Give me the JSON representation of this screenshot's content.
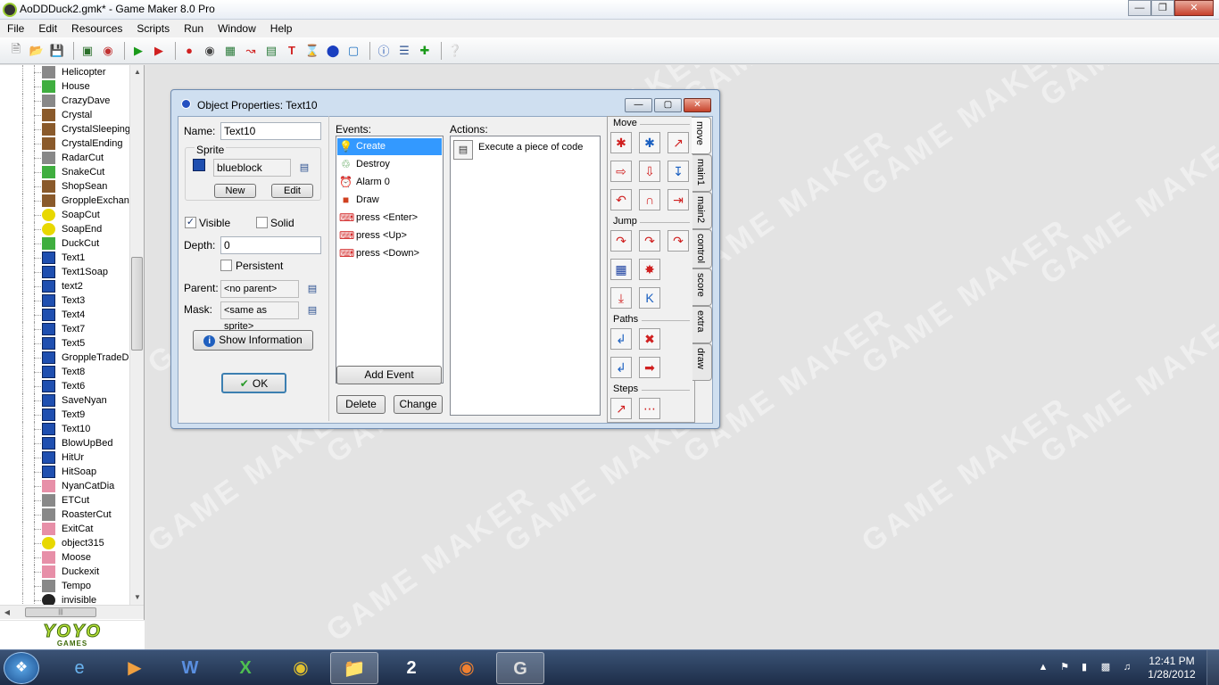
{
  "window": {
    "title": "AoDDDuck2.gmk* - Game Maker 8.0 Pro"
  },
  "menu": [
    "File",
    "Edit",
    "Resources",
    "Scripts",
    "Run",
    "Window",
    "Help"
  ],
  "tree_items": [
    {
      "label": "Helicopter",
      "icon": "gray"
    },
    {
      "label": "House",
      "icon": "green"
    },
    {
      "label": "CrazyDave",
      "icon": "gray"
    },
    {
      "label": "Crystal",
      "icon": "brown"
    },
    {
      "label": "CrystalSleeping",
      "icon": "brown"
    },
    {
      "label": "CrystalEnding",
      "icon": "brown"
    },
    {
      "label": "RadarCut",
      "icon": "gray"
    },
    {
      "label": "SnakeCut",
      "icon": "green"
    },
    {
      "label": "ShopSean",
      "icon": "brown"
    },
    {
      "label": "GroppleExchan",
      "icon": "brown"
    },
    {
      "label": "SoapCut",
      "icon": "yellow"
    },
    {
      "label": "SoapEnd",
      "icon": "yellow"
    },
    {
      "label": "DuckCut",
      "icon": "green"
    },
    {
      "label": "Text1",
      "icon": "blue"
    },
    {
      "label": "Text1Soap",
      "icon": "blue"
    },
    {
      "label": "text2",
      "icon": "blue"
    },
    {
      "label": "Text3",
      "icon": "blue"
    },
    {
      "label": "Text4",
      "icon": "blue"
    },
    {
      "label": "Text7",
      "icon": "blue"
    },
    {
      "label": "Text5",
      "icon": "blue"
    },
    {
      "label": "GroppleTradeD",
      "icon": "blue"
    },
    {
      "label": "Text8",
      "icon": "blue"
    },
    {
      "label": "Text6",
      "icon": "blue"
    },
    {
      "label": "SaveNyan",
      "icon": "blue"
    },
    {
      "label": "Text9",
      "icon": "blue"
    },
    {
      "label": "Text10",
      "icon": "blue"
    },
    {
      "label": "BlowUpBed",
      "icon": "blue"
    },
    {
      "label": "HitUr",
      "icon": "blue"
    },
    {
      "label": "HitSoap",
      "icon": "blue"
    },
    {
      "label": "NyanCatDia",
      "icon": "pink"
    },
    {
      "label": "ETCut",
      "icon": "gray"
    },
    {
      "label": "RoasterCut",
      "icon": "gray"
    },
    {
      "label": "ExitCat",
      "icon": "pink"
    },
    {
      "label": "object315",
      "icon": "yellow"
    },
    {
      "label": "Moose",
      "icon": "pink"
    },
    {
      "label": "Duckexit",
      "icon": "pink"
    },
    {
      "label": "Tempo",
      "icon": "gray"
    },
    {
      "label": "invisible",
      "icon": "dark"
    }
  ],
  "branding": {
    "logo": "YOYO",
    "sub": "GAMES"
  },
  "watermark": "GAME MAKER",
  "dialog": {
    "title": "Object Properties: Text10",
    "name_label": "Name:",
    "name_value": "Text10",
    "sprite_group": "Sprite",
    "sprite_value": "blueblock",
    "new_btn": "New",
    "edit_btn": "Edit",
    "visible_label": "Visible",
    "visible_checked": true,
    "solid_label": "Solid",
    "solid_checked": false,
    "depth_label": "Depth:",
    "depth_value": "0",
    "persistent_label": "Persistent",
    "persistent_checked": false,
    "parent_label": "Parent:",
    "parent_value": "<no parent>",
    "mask_label": "Mask:",
    "mask_value": "<same as sprite>",
    "show_info_btn": "Show Information",
    "ok_btn": "OK",
    "events_label": "Events:",
    "events": [
      {
        "label": "Create",
        "icon": "lightbulb-icon",
        "selected": true
      },
      {
        "label": "Destroy",
        "icon": "trash-icon",
        "selected": false
      },
      {
        "label": "Alarm 0",
        "icon": "clock-icon",
        "selected": false
      },
      {
        "label": "Draw",
        "icon": "paint-icon",
        "selected": false
      },
      {
        "label": "press <Enter>",
        "icon": "keyboard-icon",
        "selected": false
      },
      {
        "label": "press <Up>",
        "icon": "keyboard-icon",
        "selected": false
      },
      {
        "label": "press <Down>",
        "icon": "keyboard-icon",
        "selected": false
      }
    ],
    "add_event_btn": "Add Event",
    "delete_btn": "Delete",
    "change_btn": "Change",
    "actions_label": "Actions:",
    "actions": [
      {
        "label": "Execute a piece of code",
        "icon": "code-icon"
      }
    ]
  },
  "palette": {
    "sections": [
      "Move",
      "Jump",
      "Paths",
      "Steps"
    ],
    "tabs": [
      "move",
      "main1",
      "main2",
      "control",
      "score",
      "extra",
      "draw"
    ],
    "active_tab": "move"
  },
  "taskbar": {
    "apps": [
      "internet-explorer",
      "media-player",
      "word",
      "excel",
      "chrome",
      "file-explorer",
      "app-2x",
      "firefox",
      "game-maker"
    ],
    "active_app": "game-maker",
    "time": "12:41 PM",
    "date": "1/28/2012"
  }
}
